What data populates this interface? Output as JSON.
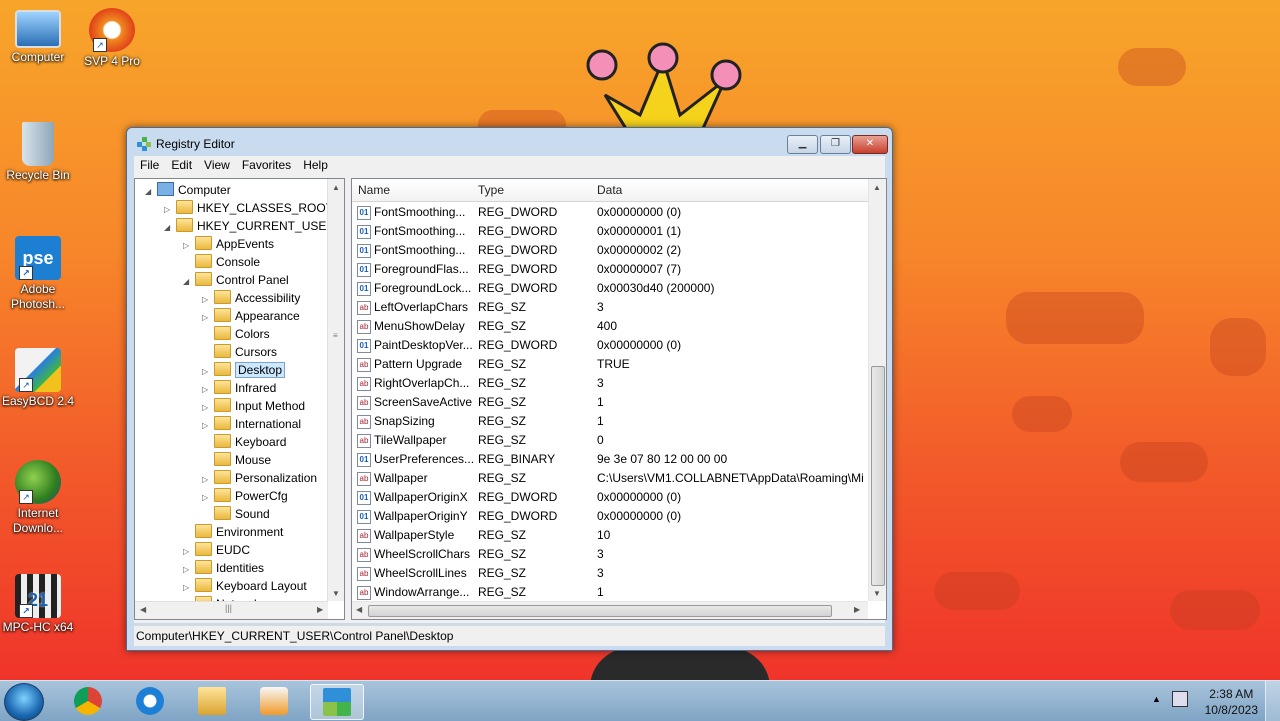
{
  "desktop": {
    "icons": [
      {
        "label": "Computer",
        "icon": "computer-icon"
      },
      {
        "label": "SVP 4 Pro",
        "icon": "svp-icon"
      },
      {
        "label": "Recycle Bin",
        "icon": "recycle-bin-icon"
      },
      {
        "label": "Adobe Photosh...",
        "icon": "photoshop-icon",
        "badge": "pse"
      },
      {
        "label": "EasyBCD 2.4",
        "icon": "easybcd-icon"
      },
      {
        "label": "Internet Downlo...",
        "icon": "internet-download-icon"
      },
      {
        "label": "MPC-HC x64",
        "icon": "mpc-hc-icon",
        "badge": "21"
      }
    ]
  },
  "window": {
    "title": "Registry Editor",
    "menu": [
      "File",
      "Edit",
      "View",
      "Favorites",
      "Help"
    ],
    "tree": [
      {
        "label": "Computer",
        "indent": 0,
        "exp": "◢",
        "kind": "computer"
      },
      {
        "label": "HKEY_CLASSES_ROOT",
        "indent": 1,
        "exp": "▷"
      },
      {
        "label": "HKEY_CURRENT_USER",
        "indent": 1,
        "exp": "◢"
      },
      {
        "label": "AppEvents",
        "indent": 2,
        "exp": "▷"
      },
      {
        "label": "Console",
        "indent": 2,
        "exp": ""
      },
      {
        "label": "Control Panel",
        "indent": 2,
        "exp": "◢"
      },
      {
        "label": "Accessibility",
        "indent": 3,
        "exp": "▷"
      },
      {
        "label": "Appearance",
        "indent": 3,
        "exp": "▷"
      },
      {
        "label": "Colors",
        "indent": 3,
        "exp": ""
      },
      {
        "label": "Cursors",
        "indent": 3,
        "exp": ""
      },
      {
        "label": "Desktop",
        "indent": 3,
        "exp": "▷",
        "selected": true
      },
      {
        "label": "Infrared",
        "indent": 3,
        "exp": "▷"
      },
      {
        "label": "Input Method",
        "indent": 3,
        "exp": "▷"
      },
      {
        "label": "International",
        "indent": 3,
        "exp": "▷"
      },
      {
        "label": "Keyboard",
        "indent": 3,
        "exp": ""
      },
      {
        "label": "Mouse",
        "indent": 3,
        "exp": ""
      },
      {
        "label": "Personalization",
        "indent": 3,
        "exp": "▷"
      },
      {
        "label": "PowerCfg",
        "indent": 3,
        "exp": "▷"
      },
      {
        "label": "Sound",
        "indent": 3,
        "exp": ""
      },
      {
        "label": "Environment",
        "indent": 2,
        "exp": ""
      },
      {
        "label": "EUDC",
        "indent": 2,
        "exp": "▷"
      },
      {
        "label": "Identities",
        "indent": 2,
        "exp": "▷"
      },
      {
        "label": "Keyboard Layout",
        "indent": 2,
        "exp": "▷"
      },
      {
        "label": "Network",
        "indent": 2,
        "exp": "▷"
      }
    ],
    "columns": {
      "name": "Name",
      "type": "Type",
      "data": "Data"
    },
    "rows": [
      {
        "name": "FontSmoothing...",
        "type": "REG_DWORD",
        "data": "0x00000000 (0)"
      },
      {
        "name": "FontSmoothing...",
        "type": "REG_DWORD",
        "data": "0x00000001 (1)"
      },
      {
        "name": "FontSmoothing...",
        "type": "REG_DWORD",
        "data": "0x00000002 (2)"
      },
      {
        "name": "ForegroundFlas...",
        "type": "REG_DWORD",
        "data": "0x00000007 (7)"
      },
      {
        "name": "ForegroundLock...",
        "type": "REG_DWORD",
        "data": "0x00030d40 (200000)"
      },
      {
        "name": "LeftOverlapChars",
        "type": "REG_SZ",
        "data": "3"
      },
      {
        "name": "MenuShowDelay",
        "type": "REG_SZ",
        "data": "400"
      },
      {
        "name": "PaintDesktopVer...",
        "type": "REG_DWORD",
        "data": "0x00000000 (0)"
      },
      {
        "name": "Pattern Upgrade",
        "type": "REG_SZ",
        "data": "TRUE"
      },
      {
        "name": "RightOverlapCh...",
        "type": "REG_SZ",
        "data": "3"
      },
      {
        "name": "ScreenSaveActive",
        "type": "REG_SZ",
        "data": "1"
      },
      {
        "name": "SnapSizing",
        "type": "REG_SZ",
        "data": "1"
      },
      {
        "name": "TileWallpaper",
        "type": "REG_SZ",
        "data": "0"
      },
      {
        "name": "UserPreferences...",
        "type": "REG_BINARY",
        "data": "9e 3e 07 80 12 00 00 00"
      },
      {
        "name": "Wallpaper",
        "type": "REG_SZ",
        "data": "C:\\Users\\VM1.COLLABNET\\AppData\\Roaming\\Mi"
      },
      {
        "name": "WallpaperOriginX",
        "type": "REG_DWORD",
        "data": "0x00000000 (0)"
      },
      {
        "name": "WallpaperOriginY",
        "type": "REG_DWORD",
        "data": "0x00000000 (0)"
      },
      {
        "name": "WallpaperStyle",
        "type": "REG_SZ",
        "data": "10"
      },
      {
        "name": "WheelScrollChars",
        "type": "REG_SZ",
        "data": "3"
      },
      {
        "name": "WheelScrollLines",
        "type": "REG_SZ",
        "data": "3"
      },
      {
        "name": "WindowArrange...",
        "type": "REG_SZ",
        "data": "1"
      }
    ],
    "status_path": "Computer\\HKEY_CURRENT_USER\\Control Panel\\Desktop"
  },
  "taskbar": {
    "pinned": [
      "chrome-icon",
      "internet-explorer-icon",
      "file-explorer-icon",
      "media-player-icon",
      "registry-editor-icon"
    ],
    "clock_time": "2:38 AM",
    "clock_date": "10/8/2023"
  }
}
